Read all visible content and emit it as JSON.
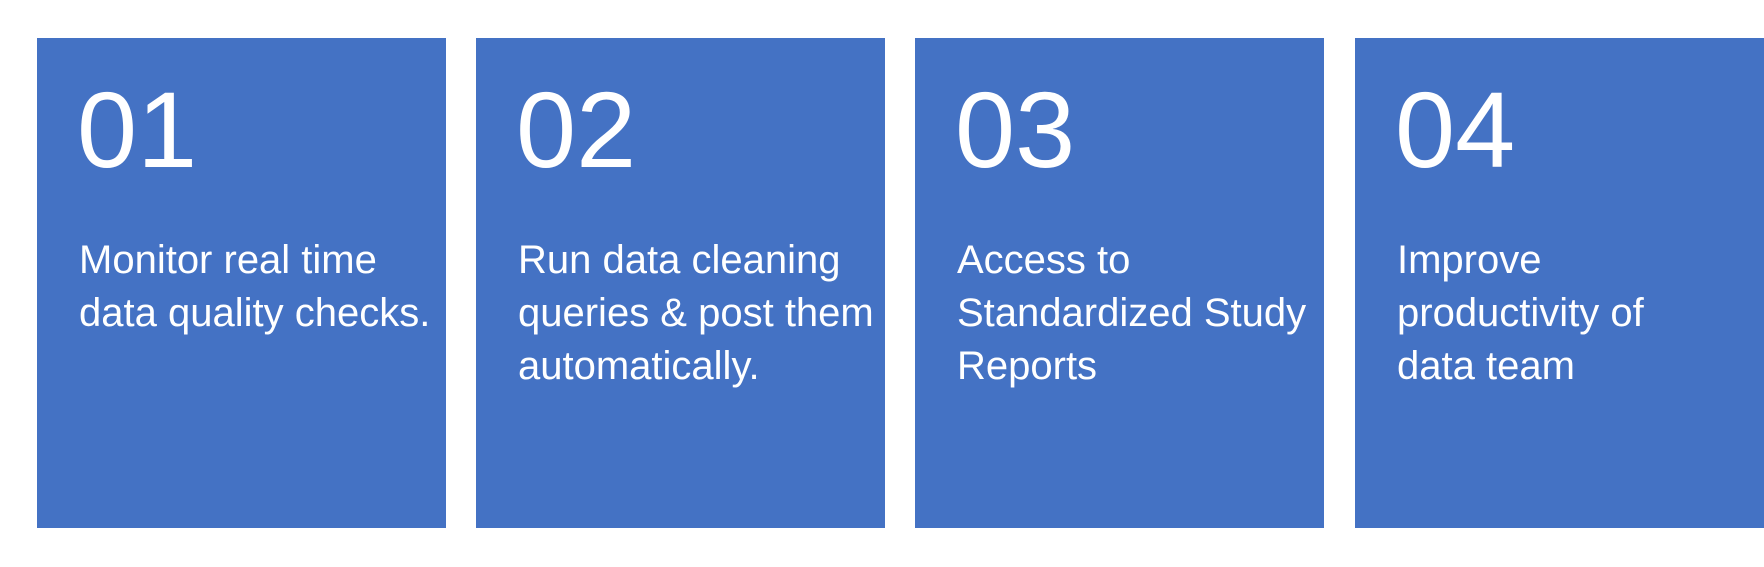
{
  "cards": [
    {
      "number": "01",
      "text": "Monitor real time data quality checks."
    },
    {
      "number": "02",
      "text": "Run data cleaning queries & post them automatically."
    },
    {
      "number": "03",
      "text": "Access to Standardized Study Reports"
    },
    {
      "number": "04",
      "text": "Improve productivity of data team"
    }
  ],
  "colors": {
    "card_background": "#4472c4",
    "text": "#ffffff",
    "page_background": "#ffffff"
  }
}
